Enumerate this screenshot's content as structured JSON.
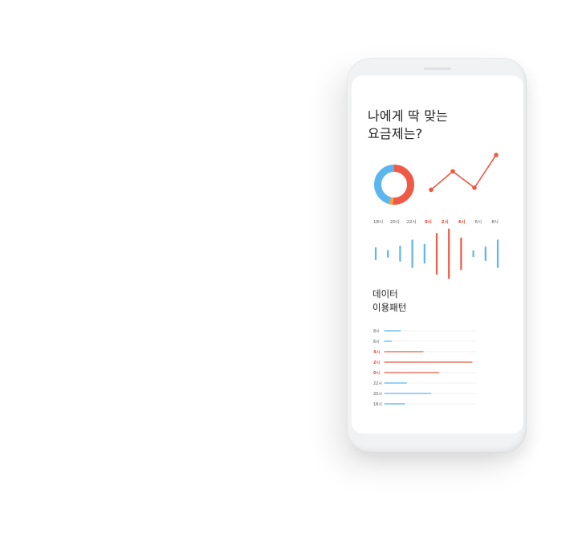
{
  "screen": {
    "headline": "나에게 딱 맞는\n요금제는?",
    "subhead": "데이터\n이용패턴"
  },
  "colors": {
    "blue": "#5bb5ef",
    "red": "#ee5a45",
    "orange": "#f2a33c",
    "track": "#ececec",
    "text_red": "#e2452f",
    "text_dark": "#555555"
  },
  "donut": {
    "segments": [
      {
        "key": "red",
        "value": 0.51
      },
      {
        "key": "orange",
        "value": 0.03
      },
      {
        "key": "blue",
        "value": 0.46
      }
    ]
  },
  "line_chart": {
    "values": [
      0.15,
      0.6,
      0.2,
      1.0
    ]
  },
  "time_labels": [
    {
      "text": "18시",
      "hl": false
    },
    {
      "text": "20시",
      "hl": false
    },
    {
      "text": "22시",
      "hl": false
    },
    {
      "text": "0시",
      "hl": true
    },
    {
      "text": "2시",
      "hl": true
    },
    {
      "text": "4시",
      "hl": true
    },
    {
      "text": "6시",
      "hl": false
    },
    {
      "text": "8시",
      "hl": false
    }
  ],
  "wave_bars": [
    {
      "h": 0.22,
      "red": false
    },
    {
      "h": 0.12,
      "red": false
    },
    {
      "h": 0.28,
      "red": false
    },
    {
      "h": 0.52,
      "red": false
    },
    {
      "h": 0.35,
      "red": false
    },
    {
      "h": 0.78,
      "red": true
    },
    {
      "h": 0.95,
      "red": true
    },
    {
      "h": 0.6,
      "red": true
    },
    {
      "h": 0.1,
      "red": false
    },
    {
      "h": 0.25,
      "red": false
    },
    {
      "h": 0.52,
      "red": false
    }
  ],
  "usage_rows": [
    {
      "label": "8시",
      "value": 0.18,
      "hl": false
    },
    {
      "label": "6시",
      "value": 0.08,
      "hl": false
    },
    {
      "label": "4시",
      "value": 0.44,
      "hl": true
    },
    {
      "label": "2시",
      "value": 1.0,
      "hl": true
    },
    {
      "label": "0시",
      "value": 0.62,
      "hl": true
    },
    {
      "label": "22시",
      "value": 0.25,
      "hl": false
    },
    {
      "label": "20시",
      "value": 0.53,
      "hl": false
    },
    {
      "label": "18시",
      "value": 0.23,
      "hl": false
    }
  ]
}
